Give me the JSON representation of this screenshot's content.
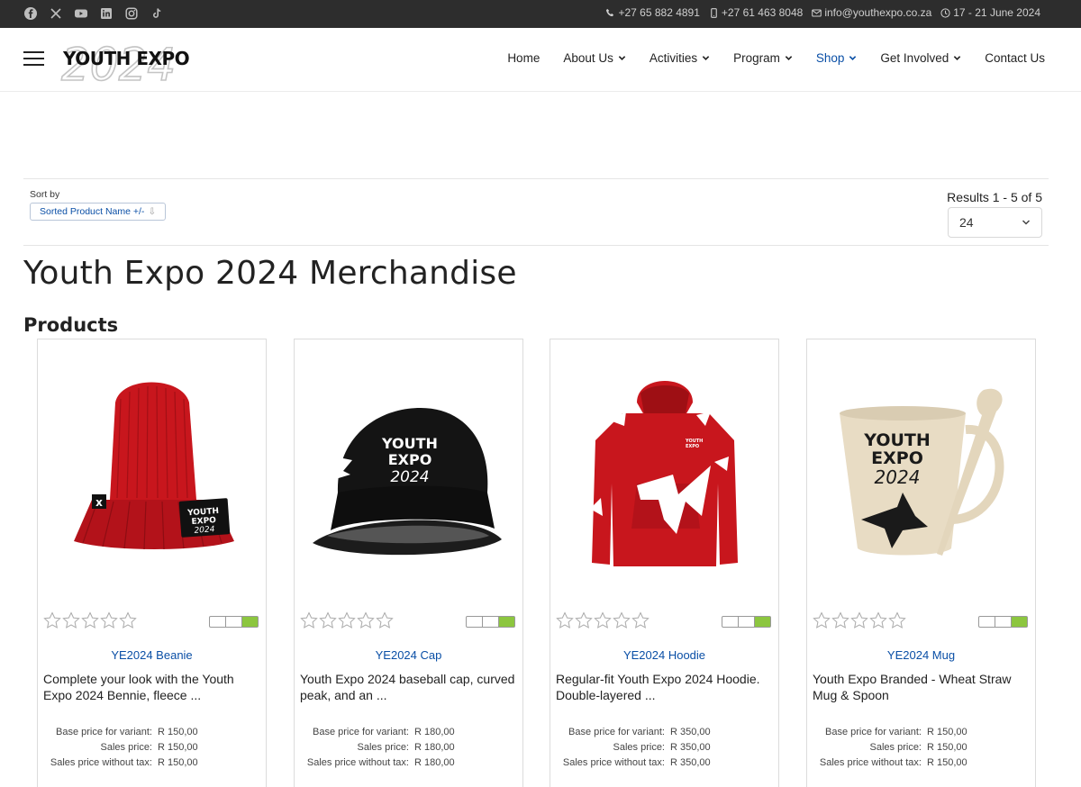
{
  "topbar": {
    "social": [
      "facebook-icon",
      "x-icon",
      "youtube-icon",
      "linkedin-icon",
      "instagram-icon",
      "tiktok-icon"
    ],
    "phone": "+27 65 882 4891",
    "mobile": "+27 61 463 8048",
    "email": "info@youthexpo.co.za",
    "dates": "17 - 21 June 2024"
  },
  "header": {
    "logo_text": "YOUTH EXPO",
    "logo_year": "2024",
    "nav": [
      {
        "label": "Home",
        "dropdown": false,
        "active": false
      },
      {
        "label": "About Us",
        "dropdown": true,
        "active": false
      },
      {
        "label": "Activities",
        "dropdown": true,
        "active": false
      },
      {
        "label": "Program",
        "dropdown": true,
        "active": false
      },
      {
        "label": "Shop",
        "dropdown": true,
        "active": true
      },
      {
        "label": "Get Involved",
        "dropdown": true,
        "active": false
      },
      {
        "label": "Contact Us",
        "dropdown": false,
        "active": false
      }
    ]
  },
  "toolbar": {
    "sort_label": "Sort by",
    "sort_value": "Sorted Product Name +/-",
    "results": "Results 1 - 5 of 5",
    "per_page": "24"
  },
  "page": {
    "title": "Youth Expo 2024 Merchandise",
    "products_heading": "Products"
  },
  "price_labels": {
    "base": "Base price for variant:",
    "sales": "Sales price:",
    "without_tax": "Sales price without tax:"
  },
  "products": [
    {
      "name": "YE2024 Beanie",
      "desc": "Complete your look with the Youth Expo 2024 Bennie, fleece ...",
      "base": "R 150,00",
      "sales": "R 150,00",
      "without_tax": "R 150,00"
    },
    {
      "name": "YE2024 Cap",
      "desc": "Youth Expo 2024 baseball cap, curved peak, and an ...",
      "base": "R 180,00",
      "sales": "R 180,00",
      "without_tax": "R 180,00"
    },
    {
      "name": "YE2024 Hoodie",
      "desc": "Regular-fit Youth Expo 2024 Hoodie. Double-layered ...",
      "base": "R 350,00",
      "sales": "R 350,00",
      "without_tax": "R 350,00"
    },
    {
      "name": "YE2024 Mug",
      "desc": "Youth Expo Branded - Wheat Straw Mug & Spoon",
      "base": "R 150,00",
      "sales": "R 150,00",
      "without_tax": "R 150,00"
    }
  ],
  "colors": {
    "accent": "#0a4fa6",
    "topbar": "#2d2d2d",
    "stock_green": "#8cc63f",
    "product_red": "#c8161d"
  }
}
